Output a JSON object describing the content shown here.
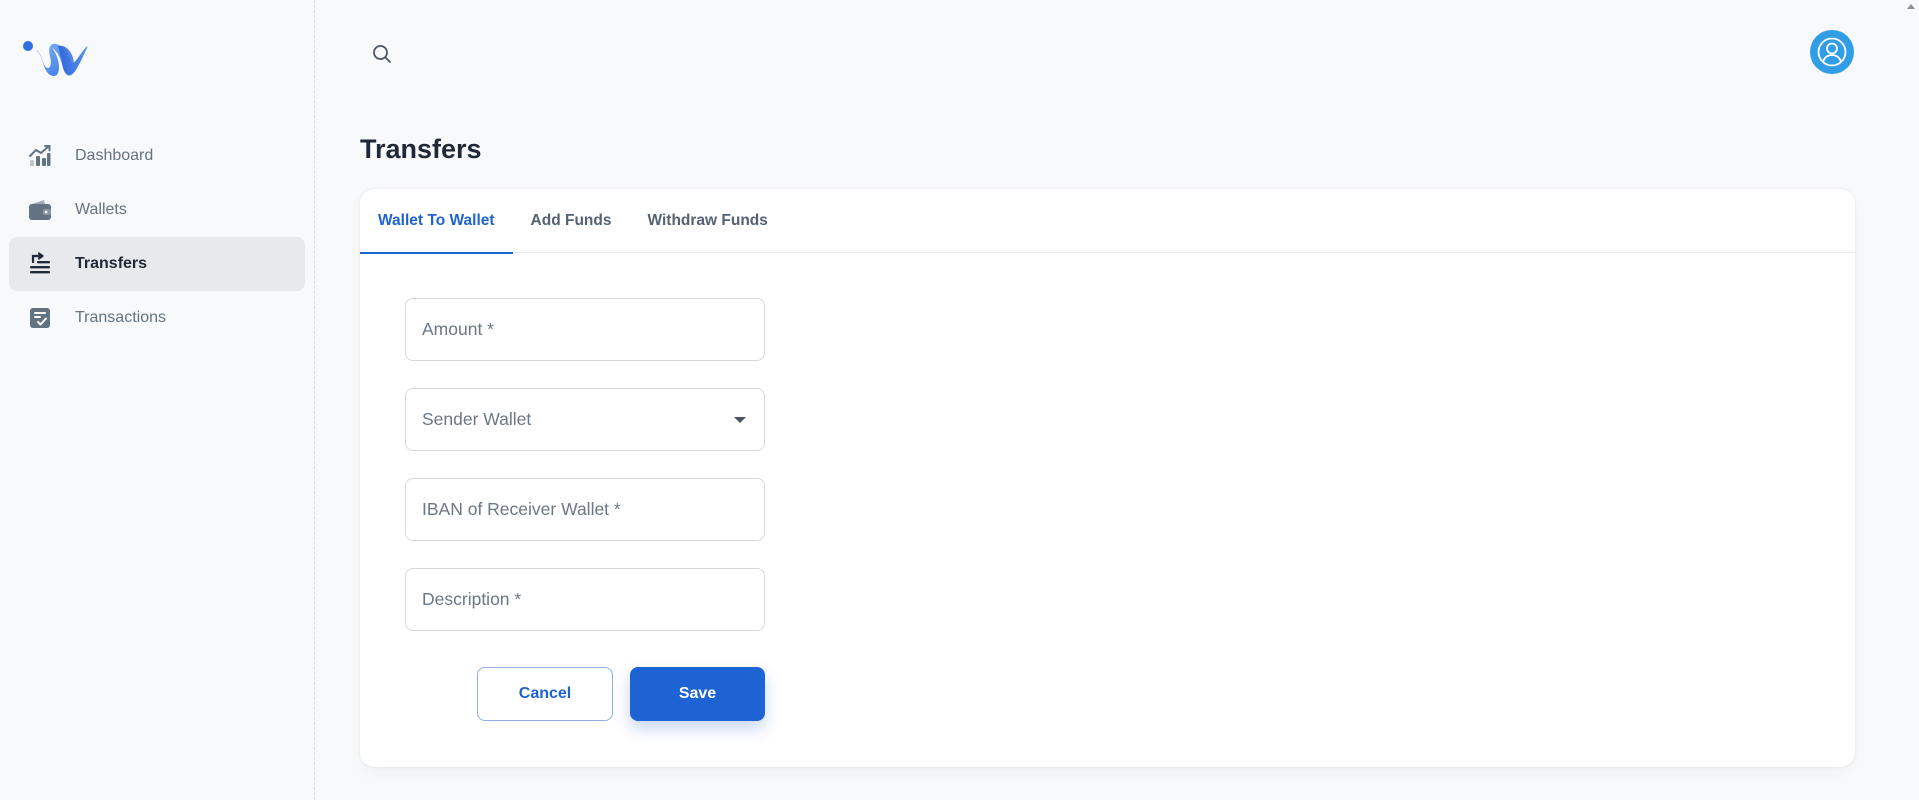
{
  "app": {
    "brand_icon": "wave-w-logo"
  },
  "sidebar": {
    "items": [
      {
        "label": "Dashboard",
        "icon": "chart-up-icon",
        "active": false
      },
      {
        "label": "Wallets",
        "icon": "wallet-icon",
        "active": false
      },
      {
        "label": "Transfers",
        "icon": "transfer-icon",
        "active": true
      },
      {
        "label": "Transactions",
        "icon": "receipt-check-icon",
        "active": false
      }
    ]
  },
  "topbar": {
    "search_icon": "search-icon",
    "avatar_icon": "user-icon"
  },
  "page": {
    "title": "Transfers"
  },
  "tabs": [
    {
      "label": "Wallet To Wallet",
      "active": true
    },
    {
      "label": "Add Funds",
      "active": false
    },
    {
      "label": "Withdraw Funds",
      "active": false
    }
  ],
  "form": {
    "amount": {
      "placeholder": "Amount *",
      "value": ""
    },
    "sender_wallet": {
      "placeholder": "Sender Wallet",
      "value": ""
    },
    "iban": {
      "placeholder": "IBAN of Receiver Wallet *",
      "value": ""
    },
    "description": {
      "placeholder": "Description *",
      "value": ""
    },
    "cancel_label": "Cancel",
    "save_label": "Save"
  },
  "colors": {
    "primary": "#1e63d4",
    "avatar": "#2f9ee6",
    "sidebar_active_bg": "#e7e9ec",
    "background": "#f8f9fb"
  }
}
